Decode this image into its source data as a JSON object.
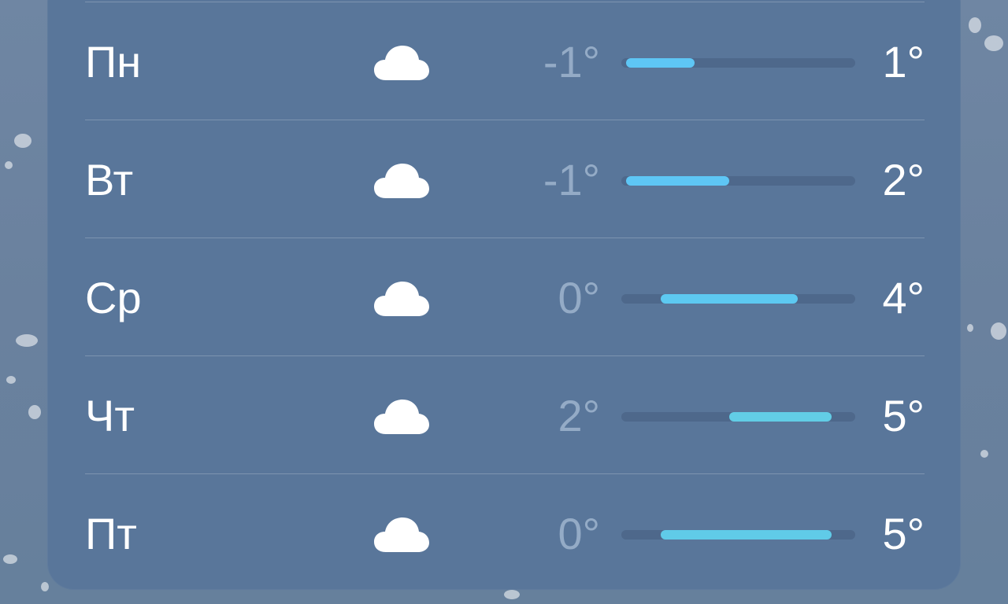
{
  "forecast": {
    "scale": {
      "min": -1,
      "max": 5
    },
    "days": [
      {
        "day": "Пн",
        "icon": "cloud-icon",
        "low": -1,
        "high": 1,
        "low_label": "-1°",
        "high_label": "1°",
        "color": "#5ec6f5"
      },
      {
        "day": "Вт",
        "icon": "cloud-icon",
        "low": -1,
        "high": 2,
        "low_label": "-1°",
        "high_label": "2°",
        "color": "#5ec6f5"
      },
      {
        "day": "Ср",
        "icon": "cloud-icon",
        "low": 0,
        "high": 4,
        "low_label": "0°",
        "high_label": "4°",
        "color": "#5dc9f1"
      },
      {
        "day": "Чт",
        "icon": "cloud-icon",
        "low": 2,
        "high": 5,
        "low_label": "2°",
        "high_label": "5°",
        "color": "#62cde6"
      },
      {
        "day": "Пт",
        "icon": "cloud-icon",
        "low": 0,
        "high": 5,
        "low_label": "0°",
        "high_label": "5°",
        "color": "#60cbe8"
      }
    ]
  }
}
